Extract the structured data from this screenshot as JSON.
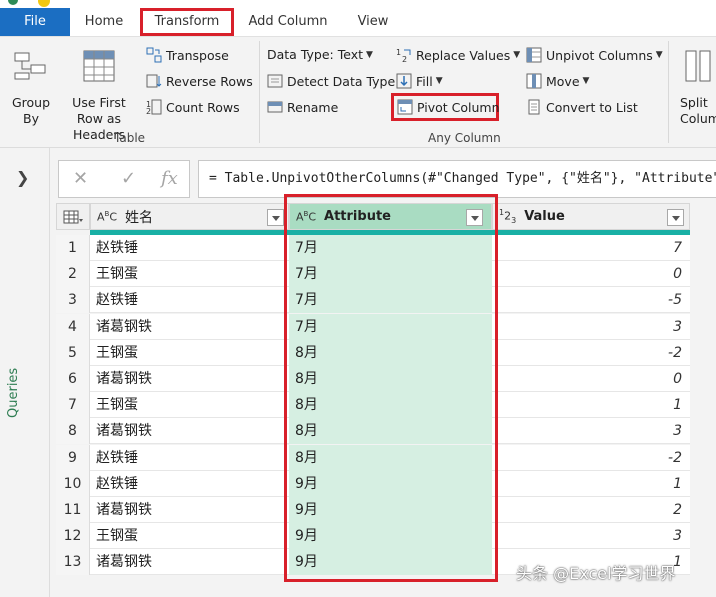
{
  "tabs": {
    "file": "File",
    "home": "Home",
    "transform": "Transform",
    "add_column": "Add Column",
    "view": "View"
  },
  "ribbon": {
    "group_by": "Group By",
    "use_first_row": "Use First Row as Headers",
    "transpose": "Transpose",
    "reverse_rows": "Reverse Rows",
    "count_rows": "Count Rows",
    "table_group": "Table",
    "data_type": "Data Type: Text",
    "detect_data_type": "Detect Data Type",
    "rename": "Rename",
    "replace_values": "Replace Values",
    "fill": "Fill",
    "pivot_column": "Pivot Column",
    "unpivot_columns": "Unpivot Columns",
    "move": "Move",
    "convert_to_list": "Convert to List",
    "any_column_group": "Any Column",
    "split_column": "Split Column"
  },
  "queries_label": "Queries",
  "formula": "= Table.UnpivotOtherColumns(#\"Changed Type\", {\"姓名\"}, \"Attribute\", \"Value\")",
  "columns": {
    "name": "姓名",
    "attribute": "Attribute",
    "value": "Value"
  },
  "rows": [
    {
      "n": "1",
      "name": "赵铁锤",
      "attr": "7月",
      "val": "7"
    },
    {
      "n": "2",
      "name": "王钢蛋",
      "attr": "7月",
      "val": "0"
    },
    {
      "n": "3",
      "name": "赵铁锤",
      "attr": "7月",
      "val": "-5"
    },
    {
      "n": "4",
      "name": "诸葛钢铁",
      "attr": "7月",
      "val": "3"
    },
    {
      "n": "5",
      "name": "王钢蛋",
      "attr": "8月",
      "val": "-2"
    },
    {
      "n": "6",
      "name": "诸葛钢铁",
      "attr": "8月",
      "val": "0"
    },
    {
      "n": "7",
      "name": "王钢蛋",
      "attr": "8月",
      "val": "1"
    },
    {
      "n": "8",
      "name": "诸葛钢铁",
      "attr": "8月",
      "val": "3"
    },
    {
      "n": "9",
      "name": "赵铁锤",
      "attr": "8月",
      "val": "-2"
    },
    {
      "n": "10",
      "name": "赵铁锤",
      "attr": "9月",
      "val": "1"
    },
    {
      "n": "11",
      "name": "诸葛钢铁",
      "attr": "9月",
      "val": "2"
    },
    {
      "n": "12",
      "name": "王钢蛋",
      "attr": "9月",
      "val": "3"
    },
    {
      "n": "13",
      "name": "诸葛钢铁",
      "attr": "9月",
      "val": "1"
    }
  ],
  "watermark": "头条 @Excel学习世界",
  "colors": {
    "accent_blue": "#1b6ec2",
    "highlight_red": "#d8202a",
    "selected_column": "#d6efe2",
    "teal_bar": "#19b0a5"
  }
}
